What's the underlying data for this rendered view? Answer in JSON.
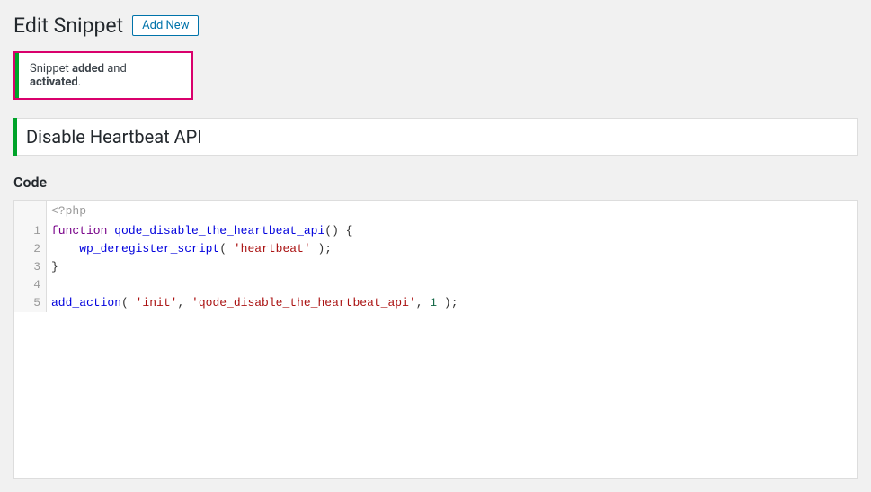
{
  "header": {
    "title": "Edit Snippet",
    "add_new_label": "Add New"
  },
  "notice": {
    "text_prefix": "Snippet ",
    "text_bold1": "added",
    "text_mid": " and ",
    "text_bold2": "activated",
    "text_suffix": "."
  },
  "snippet": {
    "title": "Disable Heartbeat API"
  },
  "code_section": {
    "label": "Code",
    "php_open": "<?php",
    "lines": {
      "l1_kw": "function",
      "l1_fn": "qode_disable_the_heartbeat_api",
      "l1_rest": "() {",
      "l2_indent": "    ",
      "l2_fn": "wp_deregister_script",
      "l2_p1": "( ",
      "l2_str": "'heartbeat'",
      "l2_p2": " );",
      "l3": "}",
      "l4": "",
      "l5_fn": "add_action",
      "l5_p1": "( ",
      "l5_str1": "'init'",
      "l5_c1": ", ",
      "l5_str2": "'qode_disable_the_heartbeat_api'",
      "l5_c2": ", ",
      "l5_num": "1",
      "l5_p2": " );"
    },
    "line_numbers": [
      "1",
      "2",
      "3",
      "4",
      "5"
    ]
  }
}
